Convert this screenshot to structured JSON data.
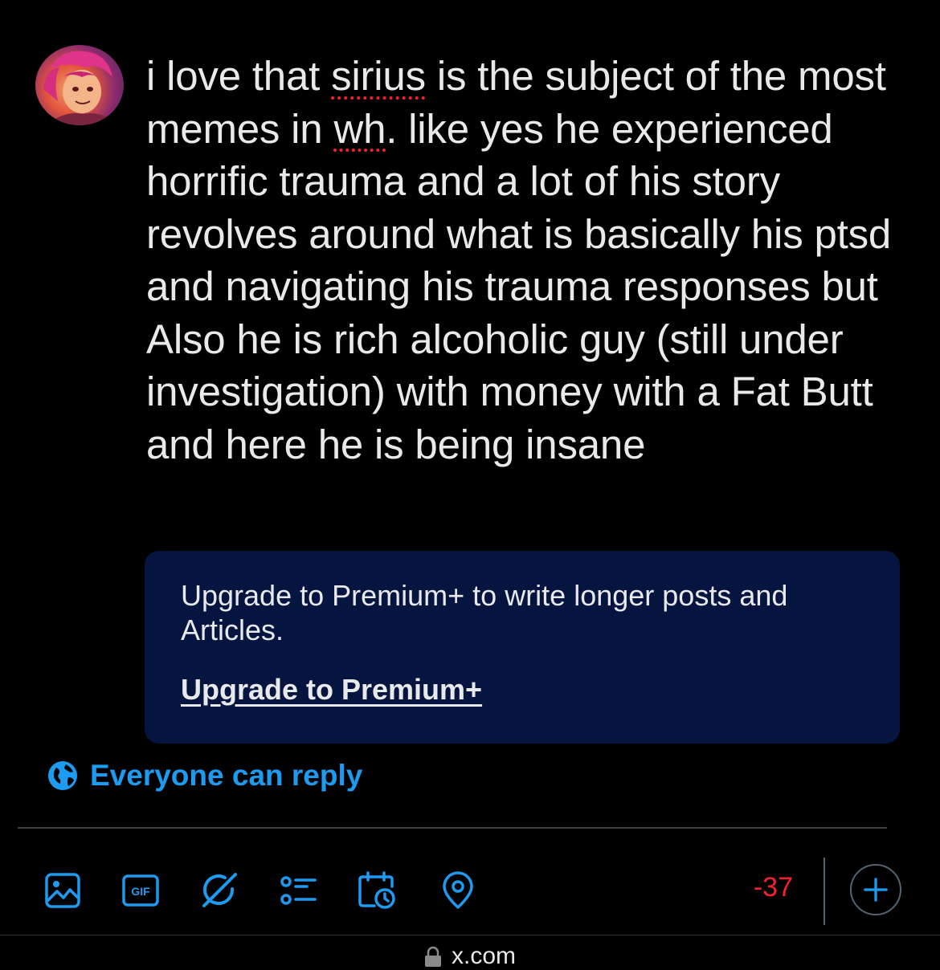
{
  "compose": {
    "segments": [
      {
        "text": "i love that ",
        "misspelled": false
      },
      {
        "text": "sirius",
        "misspelled": true
      },
      {
        "text": " is the subject of the most memes in ",
        "misspelled": false
      },
      {
        "text": "wh",
        "misspelled": true
      },
      {
        "text": ". like yes he experienced horrific trauma and a lot of his story revolves around what is basically his ptsd and navigating his trauma responses but Also he is rich alcoholic guy (still under investigation) with money with a Fat Butt and here he is being insane",
        "misspelled": false
      }
    ]
  },
  "premium_notice": {
    "message": "Upgrade to Premium+ to write longer posts and Articles.",
    "link_label": "Upgrade to Premium+"
  },
  "reply_setting": {
    "label": "Everyone can reply",
    "icon": "globe-icon"
  },
  "toolbar": {
    "icons": [
      "image-icon",
      "gif-icon",
      "grok-icon",
      "poll-icon",
      "schedule-icon",
      "location-icon"
    ],
    "gif_text": "GIF",
    "char_count": "-37",
    "add_icon": "plus-icon"
  },
  "browser": {
    "url": "x.com",
    "lock_icon": "lock-icon"
  },
  "colors": {
    "background": "#000000",
    "text": "#e7e9ea",
    "accent": "#1d9bf0",
    "premium_box": "#061540",
    "error": "#f4212e",
    "divider": "#3e4144"
  }
}
